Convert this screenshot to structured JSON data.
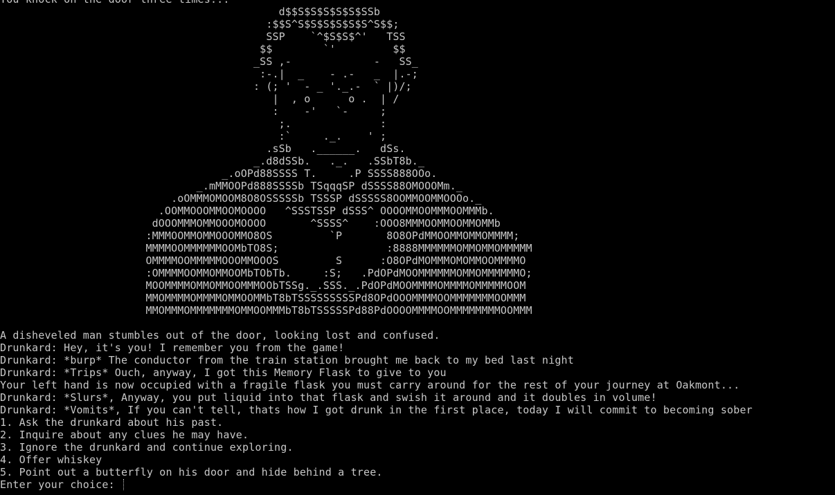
{
  "terminal": {
    "intro": "You knock on the door three times...",
    "art": [
      "                                            d$$S$S$S$S$S$SSb",
      "                                          :$$S^S$S$S$S$S$S^S$$;",
      "                                          SSP    `^$S$S$^'   TSS",
      "                                         $$        `'         $$",
      "                                        _SS ,-             -   SS_",
      "                                         :-.|  _    - .-   _  |.-;",
      "                                        : (; '  - _ '._.-  ` |)/;",
      "                                           |  , o      o .  | /",
      "                                           :    -'   `-     ;",
      "                                            ;.              :",
      "                                            :`     ._.    ' ;",
      "                                          .sSb   .______.   dSs.",
      "                                        _.d8dSSb.   ._.   .SSbT8b._",
      "                                   _.oOPd88SSSS T.     .P SSSS888OOo.",
      "                               _.mMMOOPd888SSSSb TSqqqSP dSSSS88OMOOOMm._",
      "                           .oOMMMOMOOM8O8OSSSSSb TSSSP dSSSSS8OOMMOOMMOOOo._",
      "                         .OOMMOOOMMOOMOOOO   ^SSSTSSP dSSS^ OOOOMMOOMMMOOMMMb.",
      "                        dOOOMMMOMMOOOMOOOO       ^SSSS^    :OOO8MMMOOMMOOMMOMMb",
      "                       :MMMOOMMOMMOOOMMO8OS         `P       8O8OPdMMOOMMOMMOMMMM;",
      "                       MMMMOOMMMMMMOOMbTO8S;                 :8888MMMMMMOMMOMMOMMMMM",
      "                       OMMMMOOMMMMMOOOMMOOOS         S      :O8OPdMOMMMOMOMMOOMMMMO",
      "                       :OMMMMOOMMOMMOOMbTObTb.     :S;   .PdOPdMOOMMMMMMOMMOMMMMMMO;",
      "                       MOOMMMMOMMOMMOOMMMOObTSSg._.SSS._.PdOPdMOOMMMMOMMMMOMMMMMOOM",
      "                       MMOMMMMOMMMMOMMOOMMbT8bTSSSSSSSSSPd8OPdOOOMMMMOOMMMMMMMOOMMM",
      "                       MMOMMMOMMMMMMMOMMOOMMMbT8bTSSSSSPd88PdOOOOMMMMOOMMMMMMMMOOMMM"
    ],
    "lines": [
      "A disheveled man stumbles out of the door, looking lost and confused.",
      "Drunkard: Hey, it's you! I remember you from the game!",
      "Drunkard: *burp* The conductor from the train station brought me back to my bed last night",
      "Drunkard: *Trips* Ouch, anyway, I got this Memory Flask to give to you",
      "Your left hand is now occupied with a fragile flask you must carry around for the rest of your journey at Oakmont...",
      "Drunkard: *Slurs*, Anyway, you put liquid into that flask and swish it around and it doubles in volume!",
      "Drunkard: *Vomits*, If you can't tell, thats how I got drunk in the first place, today I will commit to becoming sober"
    ],
    "choices": [
      "1. Ask the drunkard about his past.",
      "2. Inquire about any clues he may have.",
      "3. Ignore the drunkard and continue exploring.",
      "4. Offer whiskey",
      "5. Point out a butterfly on his door and hide behind a tree."
    ],
    "prompt": "Enter your choice: ",
    "text_color": "#c8c8c8",
    "background_color": "#000000"
  }
}
